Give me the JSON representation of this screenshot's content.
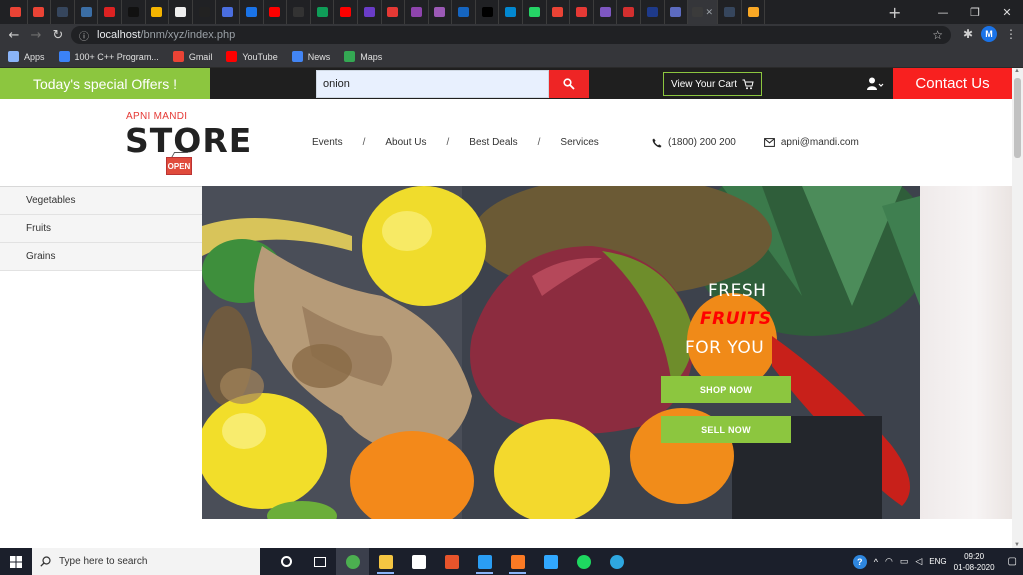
{
  "browser": {
    "tabs": [
      {
        "fav": "gmail-icon",
        "color": "#ea4335"
      },
      {
        "fav": "gmail-icon",
        "color": "#ea4335"
      },
      {
        "fav": "tumblr-icon",
        "color": "#36465d"
      },
      {
        "fav": "globe-icon",
        "color": "#3b6ea5"
      },
      {
        "fav": "red-app-icon",
        "color": "#d22"
      },
      {
        "fav": "amazon-icon",
        "color": "#111"
      },
      {
        "fav": "drive-icon",
        "color": "#f4b400"
      },
      {
        "fav": "web-icon",
        "color": "#eeeeee"
      },
      {
        "fav": "black-app-icon",
        "color": "#222"
      },
      {
        "fav": "mail-icon",
        "color": "#4a6ee0"
      },
      {
        "fav": "blue-app-icon",
        "color": "#1a73e8"
      },
      {
        "fav": "youtube-icon",
        "color": "#ff0000"
      },
      {
        "fav": "briefcase-icon",
        "color": "#333"
      },
      {
        "fav": "drive-icon",
        "color": "#0f9d58"
      },
      {
        "fav": "youtube-icon",
        "color": "#ff0000"
      },
      {
        "fav": "purple-app-icon",
        "color": "#6a3cc8"
      },
      {
        "fav": "red-app-icon",
        "color": "#e53935"
      },
      {
        "fav": "purple-app-icon",
        "color": "#8e44ad"
      },
      {
        "fav": "purple-app-icon",
        "color": "#9b59b6"
      },
      {
        "fav": "c-app-icon",
        "color": "#1565c0"
      },
      {
        "fav": "black-app-icon",
        "color": "#000"
      },
      {
        "fav": "cloud-icon",
        "color": "#0288d1"
      },
      {
        "fav": "whatsapp-icon",
        "color": "#25d366"
      },
      {
        "fav": "gmail-icon",
        "color": "#ea4335"
      },
      {
        "fav": "red-dot-icon",
        "color": "#e53935"
      },
      {
        "fav": "purple-app-icon",
        "color": "#7e57c2"
      },
      {
        "fav": "pdf-icon",
        "color": "#d32f2f"
      },
      {
        "fav": "flag-icon",
        "color": "#1e3a8a"
      },
      {
        "fav": "cloud-icon",
        "color": "#5c6bc0"
      },
      {
        "fav": "active-tab",
        "color": "#3b3b3b",
        "active": true
      },
      {
        "fav": "tumblr-icon",
        "color": "#36465d"
      },
      {
        "fav": "chart-icon",
        "color": "#f9a825"
      }
    ],
    "url_host": "localhost",
    "url_path": "/bnm/xyz/index.php",
    "profile_initial": "M",
    "bookmarks": [
      {
        "label": "Apps",
        "color": "#8ab4f8"
      },
      {
        "label": "100+ C++ Program...",
        "color": "#3b82f6"
      },
      {
        "label": "Gmail",
        "color": "#ea4335"
      },
      {
        "label": "YouTube",
        "color": "#ff0000"
      },
      {
        "label": "News",
        "color": "#4285f4"
      },
      {
        "label": "Maps",
        "color": "#34a853"
      }
    ]
  },
  "site": {
    "offers_label": "Today's special Offers !",
    "search_value": "onion",
    "cart_label": "View Your Cart",
    "contact_label": "Contact Us",
    "brand_small": "APNI MANDI",
    "brand_big": "STORE",
    "brand_sign": "OPEN",
    "nav": [
      "Events",
      "About Us",
      "Best Deals",
      "Services"
    ],
    "nav_sep": "/",
    "phone": "(1800) 200 200",
    "email": "apni@mandi.com",
    "categories": [
      "Vegetables",
      "Fruits",
      "Grains"
    ],
    "hero": {
      "line1": "FRESH",
      "line2": "FRUITS",
      "line3": "FOR YOU",
      "shop_btn": "SHOP NOW",
      "sell_btn": "SELL NOW"
    },
    "colors": {
      "green": "#8cc63f",
      "red": "#f8201f",
      "dark": "#1f1f1f"
    }
  },
  "taskbar": {
    "search_placeholder": "Type here to search",
    "apps": [
      {
        "name": "cortana-icon"
      },
      {
        "name": "task-view-icon"
      },
      {
        "name": "chrome-icon",
        "active": true
      },
      {
        "name": "file-explorer-icon",
        "open": true
      },
      {
        "name": "store-icon"
      },
      {
        "name": "office-icon"
      },
      {
        "name": "vscode-icon",
        "open": true
      },
      {
        "name": "xampp-icon",
        "open": true
      },
      {
        "name": "photoshop-icon"
      },
      {
        "name": "spotify-icon"
      },
      {
        "name": "edge-icon"
      }
    ],
    "lang": "ENG",
    "time": "09:20",
    "date": "01-08-2020"
  }
}
